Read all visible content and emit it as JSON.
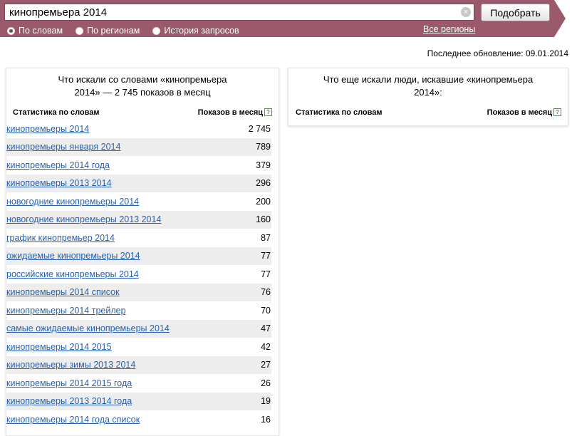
{
  "search": {
    "query": "кинопремьера 2014",
    "submit_label": "Подобрать",
    "clear_icon": "close-icon"
  },
  "modes": [
    {
      "label": "По словам",
      "selected": true
    },
    {
      "label": "По регионам",
      "selected": false
    },
    {
      "label": "История запросов",
      "selected": false
    }
  ],
  "regions_link": "Все регионы",
  "last_update": "Последнее обновление: 09.01.2014",
  "left_panel": {
    "title": "Что искали со словами «кинопремьера 2014» — 2 745 показов в месяц",
    "col_words": "Статистика по словам",
    "col_shows": "Показов в месяц",
    "help": "?",
    "rows": [
      {
        "phrase": "кинопремьеры 2014",
        "count": "2 745"
      },
      {
        "phrase": "кинопремьеры января 2014",
        "count": "789"
      },
      {
        "phrase": "кинопремьеры 2014 года",
        "count": "379"
      },
      {
        "phrase": "кинопремьеры 2013 2014",
        "count": "296"
      },
      {
        "phrase": "новогодние кинопремьеры 2014",
        "count": "200"
      },
      {
        "phrase": "новогодние кинопремьеры 2013 2014",
        "count": "160"
      },
      {
        "phrase": "график кинопремьер 2014",
        "count": "87"
      },
      {
        "phrase": "ожидаемые кинопремьеры 2014",
        "count": "77"
      },
      {
        "phrase": "российские кинопремьеры 2014",
        "count": "77"
      },
      {
        "phrase": "кинопремьеры 2014 список",
        "count": "76"
      },
      {
        "phrase": "кинопремьеры 2014 трейлер",
        "count": "70"
      },
      {
        "phrase": "самые ожидаемые кинопремьеры 2014",
        "count": "47"
      },
      {
        "phrase": "кинопремьеры 2014 2015",
        "count": "42"
      },
      {
        "phrase": "кинопремьеры зимы 2013 2014",
        "count": "27"
      },
      {
        "phrase": "кинопремьеры 2014 2015 года",
        "count": "26"
      },
      {
        "phrase": "кинопремьеры 2013 2014 года",
        "count": "19"
      },
      {
        "phrase": "кинопремьеры 2014 года список",
        "count": "16"
      }
    ]
  },
  "right_panel": {
    "title": "Что еще искали люди, искавшие «кинопремьера 2014»:",
    "col_words": "Статистика по словам",
    "col_shows": "Показов в месяц",
    "help": "?"
  },
  "colors": {
    "topbar": "#9a5a6c",
    "link": "#2860b0",
    "row_alt": "#ededed"
  }
}
